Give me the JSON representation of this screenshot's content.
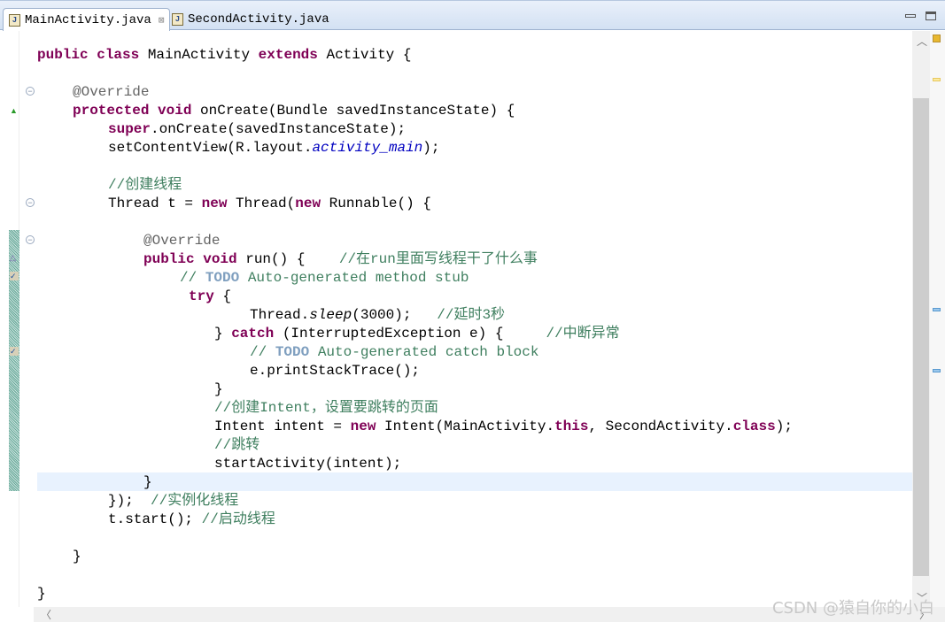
{
  "tabs": [
    {
      "label": "MainActivity.java",
      "active": true,
      "close": "⊠"
    },
    {
      "label": "SecondActivity.java",
      "active": false
    }
  ],
  "watermark": "CSDN @猿自你的小白",
  "colors": {
    "keyword": "#7f0055",
    "comment": "#3f7f5f",
    "annotation": "#646464",
    "field": "#0000c0",
    "current_line": "#e8f2fe"
  },
  "code": [
    {
      "indent": 0,
      "seg": [
        [
          "kw",
          "public class "
        ],
        [
          "",
          "MainActivity "
        ],
        [
          "kw",
          "extends "
        ],
        [
          "",
          "Activity {"
        ]
      ]
    },
    {
      "indent": 0,
      "seg": []
    },
    {
      "indent": 1,
      "seg": [
        [
          "an",
          "@Override"
        ]
      ]
    },
    {
      "indent": 1,
      "seg": [
        [
          "kw",
          "protected void "
        ],
        [
          "",
          "onCreate(Bundle savedInstanceState) {"
        ]
      ]
    },
    {
      "indent": 2,
      "seg": [
        [
          "kw",
          "super"
        ],
        [
          "",
          ".onCreate(savedInstanceState);"
        ]
      ]
    },
    {
      "indent": 2,
      "seg": [
        [
          "",
          "setContentView(R.layout."
        ],
        [
          "fld",
          "activity_main"
        ],
        [
          "",
          ");"
        ]
      ]
    },
    {
      "indent": 2,
      "seg": []
    },
    {
      "indent": 2,
      "seg": [
        [
          "cm",
          "//创建线程"
        ]
      ]
    },
    {
      "indent": 2,
      "seg": [
        [
          "",
          "Thread t = "
        ],
        [
          "kw",
          "new "
        ],
        [
          "",
          "Thread("
        ],
        [
          "kw",
          "new "
        ],
        [
          "",
          "Runnable() {"
        ]
      ]
    },
    {
      "indent": 2,
      "seg": []
    },
    {
      "indent": 3,
      "seg": [
        [
          "an",
          "@Override"
        ]
      ]
    },
    {
      "indent": 3,
      "seg": [
        [
          "kw",
          "public void "
        ],
        [
          "",
          "run() {    "
        ],
        [
          "cm",
          "//在run里面写线程干了什么事"
        ]
      ]
    },
    {
      "indent": "203",
      "seg": [
        [
          "tc",
          "// "
        ],
        [
          "todo",
          "TODO"
        ],
        [
          "tc",
          " Auto-generated method stub"
        ]
      ]
    },
    {
      "indent": "213",
      "seg": [
        [
          "kw",
          "try "
        ],
        [
          "",
          "{"
        ]
      ]
    },
    {
      "indent": "282",
      "seg": [
        [
          "",
          "Thread."
        ],
        [
          "st",
          "sleep"
        ],
        [
          "",
          "(3000);   "
        ],
        [
          "cm",
          "//延时3秒"
        ]
      ]
    },
    {
      "indent": "242",
      "seg": [
        [
          "",
          "} "
        ],
        [
          "kw",
          "catch "
        ],
        [
          "",
          "(InterruptedException e) {     "
        ],
        [
          "cm",
          "//中断异常"
        ]
      ]
    },
    {
      "indent": "282",
      "seg": [
        [
          "tc",
          "// "
        ],
        [
          "todo",
          "TODO"
        ],
        [
          "tc",
          " Auto-generated catch block"
        ]
      ]
    },
    {
      "indent": "282",
      "seg": [
        [
          "",
          "e.printStackTrace();"
        ]
      ]
    },
    {
      "indent": "242",
      "seg": [
        [
          "",
          "}"
        ]
      ]
    },
    {
      "indent": "242",
      "seg": [
        [
          "cm",
          "//创建Intent，设置要跳转的页面"
        ]
      ]
    },
    {
      "indent": "242",
      "seg": [
        [
          "",
          "Intent intent = "
        ],
        [
          "kw",
          "new "
        ],
        [
          "",
          "Intent(MainActivity."
        ],
        [
          "kw",
          "this"
        ],
        [
          "",
          ", SecondActivity."
        ],
        [
          "kw",
          "class"
        ],
        [
          "",
          ");"
        ]
      ]
    },
    {
      "indent": "242",
      "seg": [
        [
          "cm",
          "//跳转"
        ]
      ]
    },
    {
      "indent": "242",
      "seg": [
        [
          "",
          "startActivity(intent);"
        ]
      ]
    },
    {
      "indent": 3,
      "seg": [
        [
          "",
          "}"
        ]
      ]
    },
    {
      "indent": 2,
      "seg": [
        [
          "",
          "});  "
        ],
        [
          "cm",
          "//实例化线程"
        ]
      ]
    },
    {
      "indent": 2,
      "seg": [
        [
          "",
          "t.start(); "
        ],
        [
          "cm",
          "//启动线程"
        ]
      ]
    },
    {
      "indent": 2,
      "seg": []
    },
    {
      "indent": 1,
      "seg": [
        [
          "",
          "}"
        ]
      ]
    },
    {
      "indent": 1,
      "seg": []
    },
    {
      "indent": 0,
      "seg": [
        [
          "",
          "}"
        ]
      ]
    }
  ]
}
